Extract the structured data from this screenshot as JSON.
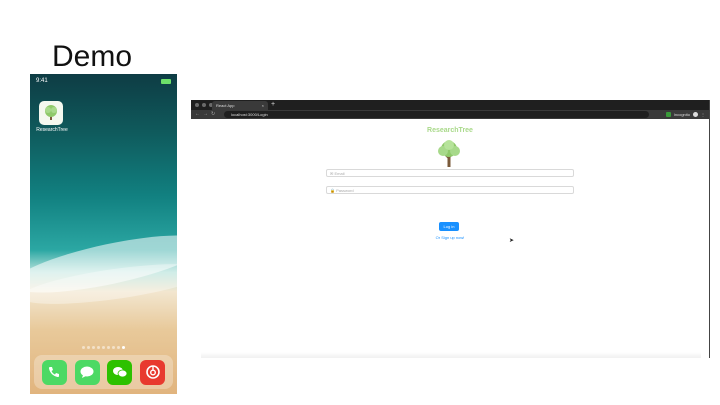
{
  "slide": {
    "title": "Demo"
  },
  "phone": {
    "time": "9:41",
    "app": {
      "label": "ResearchTree"
    },
    "dock": [
      "phone",
      "messages",
      "wechat",
      "netease-music"
    ]
  },
  "browser": {
    "tab_title": "React App",
    "url": "localhost:3000/Login",
    "profile_label": "Incognito"
  },
  "page": {
    "brand": "ResearchTree",
    "email_placeholder": "Email",
    "password_placeholder": "Password",
    "login_label": "Log in",
    "signup_text": "Or Sign up now!"
  }
}
